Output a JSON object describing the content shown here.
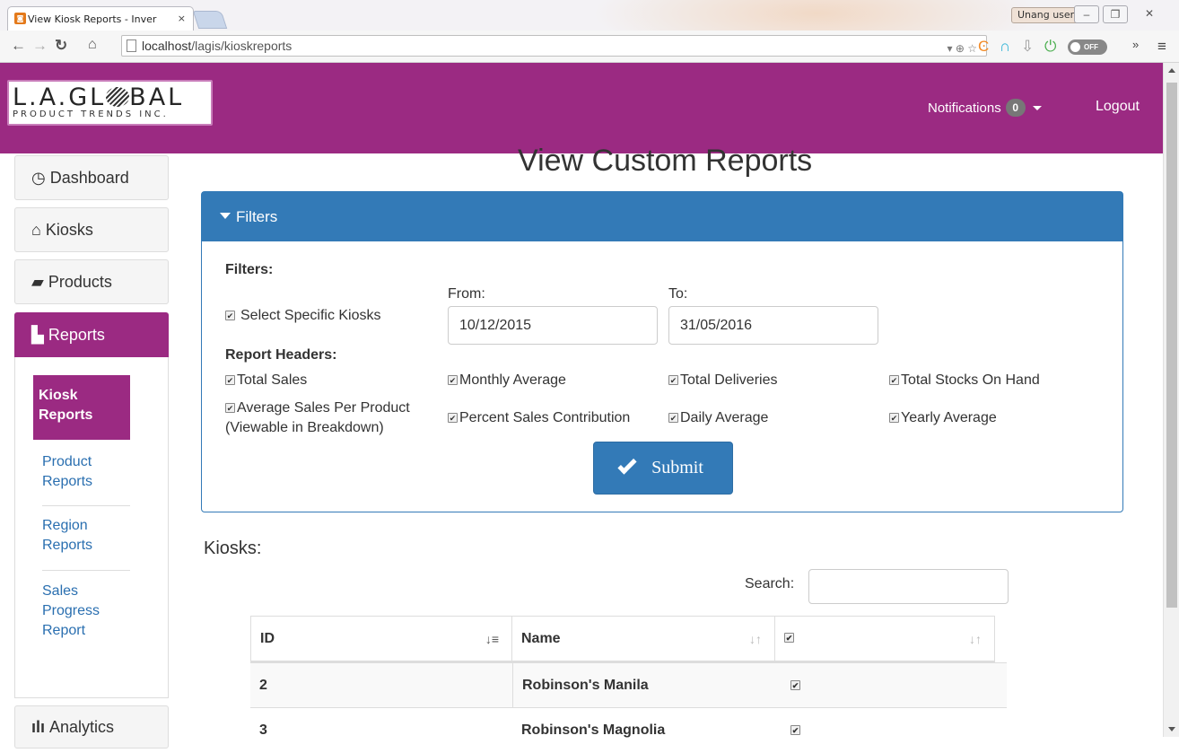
{
  "browser": {
    "tab_title": "View Kiosk Reports - Inver",
    "tab_close": "×",
    "url_host": "localhost",
    "url_path": "/lagis/kioskreports",
    "user_button": "Unang user",
    "off_label": "OFF"
  },
  "header": {
    "logo_top_left": "L.A.GL",
    "logo_top_right": "BAL",
    "logo_bottom": "PRODUCT TRENDS INC.",
    "notifications_label": "Notifications",
    "notifications_count": "0",
    "logout_label": "Logout"
  },
  "sidebar": {
    "items": [
      {
        "label": "Dashboard",
        "icon": "dashboard-icon"
      },
      {
        "label": "Kiosks",
        "icon": "home-icon"
      },
      {
        "label": "Products",
        "icon": "briefcase-icon"
      },
      {
        "label": "Reports",
        "icon": "file-icon"
      },
      {
        "label": "Analytics",
        "icon": "stats-icon"
      }
    ],
    "subitems": [
      "Kiosk Reports",
      "Product Reports",
      "Region Reports",
      "Sales Progress Report"
    ]
  },
  "main": {
    "title": "View Custom Reports",
    "panel_title": "Filters",
    "filters_label": "Filters:",
    "select_kiosks_label": "Select Specific Kiosks",
    "from_label": "From:",
    "to_label": "To:",
    "from_value": "10/12/2015",
    "to_value": "31/05/2016",
    "report_headers_label": "Report Headers:",
    "headers": [
      "Total Sales",
      "Monthly Average",
      "Total Deliveries",
      "Total Stocks On Hand",
      "Average Sales Per Product",
      "(Viewable in Breakdown)",
      "Percent Sales Contribution",
      "Daily Average",
      "Yearly Average"
    ],
    "submit_label": "Submit",
    "kiosks_title": "Kiosks:",
    "search_label": "Search:",
    "search_value": ""
  },
  "table": {
    "columns": [
      "ID",
      "Name"
    ],
    "rows": [
      {
        "id": "2",
        "name": "Robinson's Manila"
      },
      {
        "id": "3",
        "name": "Robinson's Magnolia"
      }
    ]
  }
}
